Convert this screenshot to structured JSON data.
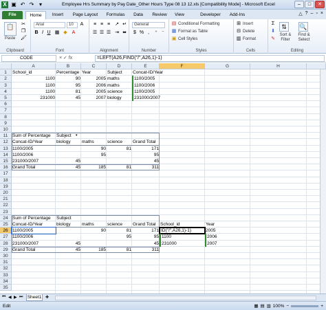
{
  "window": {
    "title": "Employee Hrs Summary by Pay Date_Other Hours Type 08 13 12.xls  [Compatibility Mode]  -  Microsoft Excel",
    "minimize": "–",
    "maximize": "□",
    "close": "✕"
  },
  "tabs": {
    "file": "File",
    "home": "Home",
    "insert": "Insert",
    "page_layout": "Page Layout",
    "formulas": "Formulas",
    "data": "Data",
    "review": "Review",
    "view": "View",
    "developer": "Developer",
    "addins": "Add-Ins"
  },
  "ribbon": {
    "clipboard": {
      "paste": "Paste",
      "label": "Clipboard"
    },
    "font": {
      "name": "Arial",
      "size": "10",
      "bold": "B",
      "italic": "I",
      "underline": "U",
      "label": "Font"
    },
    "alignment": {
      "label": "Alignment"
    },
    "number": {
      "format": "General",
      "currency": "$",
      "percent": "%",
      "comma": ",",
      "label": "Number"
    },
    "styles": {
      "conditional": "Conditional Formatting",
      "format_table": "Format as Table",
      "cell_styles": "Cell Styles",
      "label": "Styles"
    },
    "cells": {
      "insert": "Insert",
      "delete": "Delete",
      "format": "Format",
      "label": "Cells"
    },
    "editing": {
      "sort": "Sort & Filter",
      "find": "Find & Select",
      "label": "Editing"
    }
  },
  "formula_bar": {
    "name_box": "CODE",
    "fx": "× ✓ fx",
    "formula": "=LEFT(A26,FIND(\"/\",A26,1)-1)"
  },
  "columns": [
    "A",
    "B",
    "C",
    "D",
    "E",
    "F",
    "G",
    "H"
  ],
  "rows": [
    "1",
    "2",
    "3",
    "4",
    "5",
    "6",
    "7",
    "8",
    "9",
    "10",
    "11",
    "12",
    "13",
    "14",
    "15",
    "16",
    "17",
    "18",
    "19",
    "20",
    "21",
    "22",
    "23",
    "24",
    "25",
    "26",
    "27",
    "28",
    "29",
    "30",
    "31",
    "32",
    "33",
    "34",
    "35"
  ],
  "table1": {
    "headers": [
      "School_id",
      "Percentage",
      "Year",
      "Subject",
      "Concat-ID/Year"
    ],
    "rows": [
      [
        "1100",
        "90",
        "2005",
        "maths",
        "1100/2005"
      ],
      [
        "1100",
        "95",
        "2006",
        "maths",
        "1100/2006"
      ],
      [
        "1100",
        "81",
        "2005",
        "science",
        "1100/2005"
      ],
      [
        "231000",
        "45",
        "2007",
        "biology",
        "231000/2007"
      ]
    ]
  },
  "pivot1": {
    "title": "Sum of Percentage",
    "subject": "Subject",
    "row_label": "Concat-ID/Year",
    "cols": [
      "biology",
      "maths",
      "science",
      "Grand Total"
    ],
    "rows": [
      [
        "1100/2005",
        "",
        "90",
        "81",
        "171"
      ],
      [
        "1100/2006",
        "",
        "95",
        "",
        "95"
      ],
      [
        "231000/2007",
        "45",
        "",
        "",
        "45"
      ],
      [
        "Grand Total",
        "45",
        "185",
        "81",
        "311"
      ]
    ]
  },
  "pivot2": {
    "title": "Sum of Percentage",
    "subject": "Subject",
    "row_label": "Concat-ID/Year",
    "cols": [
      "biology",
      "maths",
      "science",
      "Grand Total"
    ],
    "rows": [
      [
        "1100/2005",
        "",
        "90",
        "81",
        "171"
      ],
      [
        "1100/2006",
        "",
        "",
        "95",
        "95"
      ],
      [
        "231000/2007",
        "45",
        "",
        "",
        "45"
      ],
      [
        "Grand Total",
        "45",
        "185",
        "81",
        "311"
      ]
    ],
    "extra_header": [
      "School_id",
      "Year"
    ],
    "extra_rows": [
      [
        "ID(\"/\",A26,1)-1)",
        "2005"
      ],
      [
        "1100",
        "2006"
      ],
      [
        "231000",
        "2007"
      ]
    ]
  },
  "sheet": {
    "tab": "Sheet1"
  },
  "status": {
    "mode": "Edit",
    "zoom": "100%"
  }
}
